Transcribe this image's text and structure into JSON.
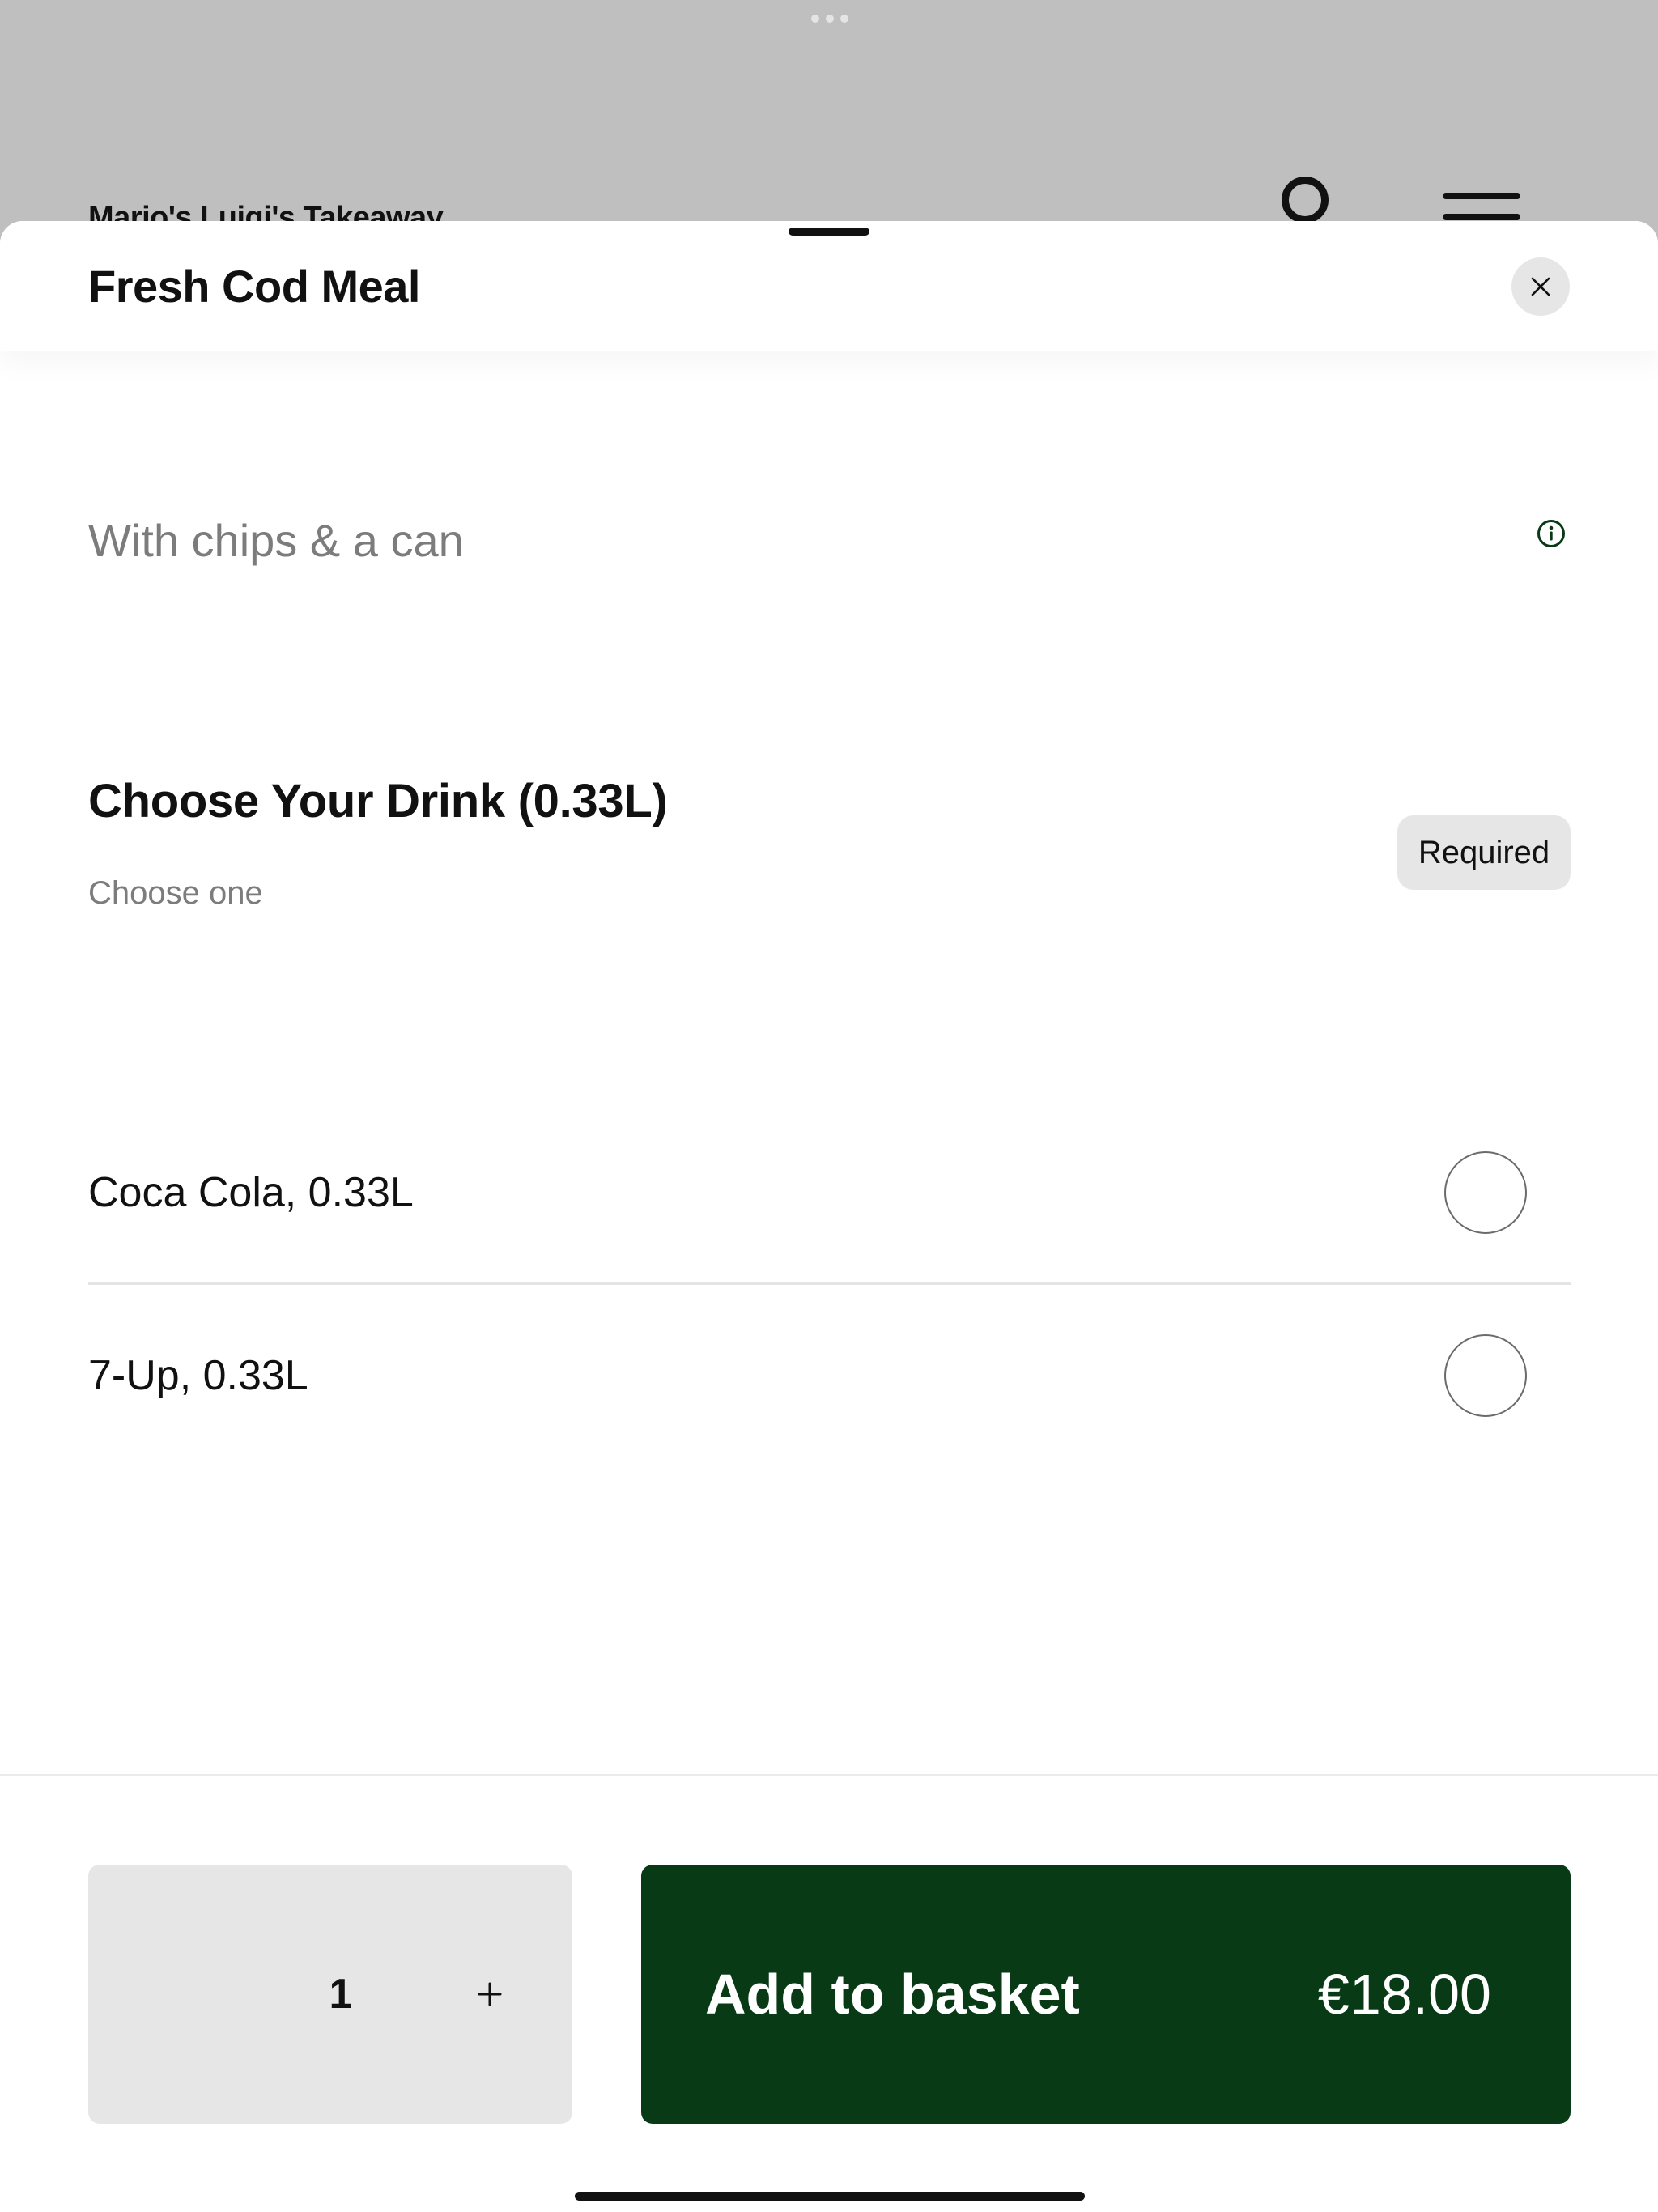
{
  "background_app": {
    "title": "Mario's Luigi's Takeaway",
    "search_icon": "search-icon",
    "menu_icon": "menu-icon"
  },
  "sheet": {
    "title": "Fresh Cod Meal",
    "close_icon": "close-icon",
    "description": "With chips & a can",
    "info_icon": "info-icon"
  },
  "drink_section": {
    "title": "Choose Your Drink (0.33L)",
    "subtitle": "Choose one",
    "badge": "Required",
    "options": [
      {
        "label": "Coca Cola, 0.33L",
        "selected": false
      },
      {
        "label": "7-Up, 0.33L",
        "selected": false
      }
    ]
  },
  "footer": {
    "quantity": "1",
    "plus_icon": "plus-icon",
    "add_label": "Add to basket",
    "price": "€18.00"
  },
  "colors": {
    "accent": "#083a16",
    "background_dim": "#bfbfbf",
    "badge_bg": "#e6e6e6"
  }
}
